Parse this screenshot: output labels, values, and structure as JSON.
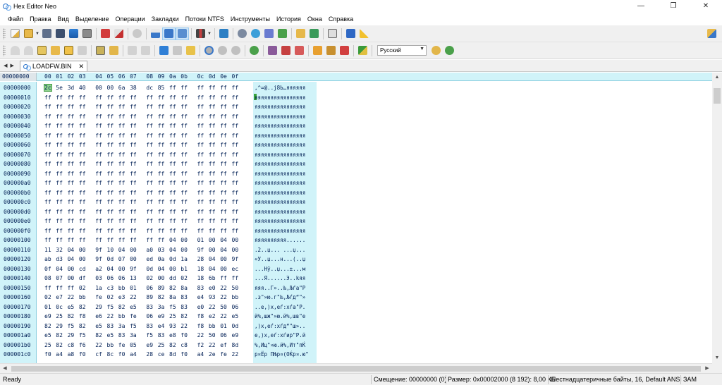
{
  "window": {
    "title": "Hex Editor Neo",
    "controls": [
      "—",
      "❐",
      "✕"
    ]
  },
  "menu": [
    "Файл",
    "Правка",
    "Вид",
    "Выделение",
    "Операции",
    "Закладки",
    "Потоки NTFS",
    "Инструменты",
    "История",
    "Окна",
    "Справка"
  ],
  "toolbar": {
    "language": "Русский"
  },
  "tabs": {
    "nav_label": "◀ ▶",
    "active_label": "LOADFW.BIN",
    "close": "✕"
  },
  "hex": {
    "header_offset": "00000000",
    "columns": [
      "00",
      "01",
      "02",
      "03",
      "04",
      "05",
      "06",
      "07",
      "08",
      "09",
      "0a",
      "0b",
      "0c",
      "0d",
      "0e",
      "0f"
    ],
    "rows": [
      {
        "offset": "00000000",
        "bytes": [
          "2c",
          "5e",
          "3d",
          "40",
          "00",
          "00",
          "6a",
          "38",
          "dc",
          "85",
          "ff",
          "ff",
          "ff",
          "ff",
          "ff",
          "ff"
        ],
        "ascii": ",^=@..j8Ь…яяяяяя"
      },
      {
        "offset": "00000010",
        "bytes": [
          "ff",
          "ff",
          "ff",
          "ff",
          "ff",
          "ff",
          "ff",
          "ff",
          "ff",
          "ff",
          "ff",
          "ff",
          "ff",
          "ff",
          "ff",
          "ff"
        ],
        "ascii": "яяяяяяяяяяяяяяяя"
      },
      {
        "offset": "00000020",
        "bytes": [
          "ff",
          "ff",
          "ff",
          "ff",
          "ff",
          "ff",
          "ff",
          "ff",
          "ff",
          "ff",
          "ff",
          "ff",
          "ff",
          "ff",
          "ff",
          "ff"
        ],
        "ascii": "яяяяяяяяяяяяяяяя"
      },
      {
        "offset": "00000030",
        "bytes": [
          "ff",
          "ff",
          "ff",
          "ff",
          "ff",
          "ff",
          "ff",
          "ff",
          "ff",
          "ff",
          "ff",
          "ff",
          "ff",
          "ff",
          "ff",
          "ff"
        ],
        "ascii": "яяяяяяяяяяяяяяяя"
      },
      {
        "offset": "00000040",
        "bytes": [
          "ff",
          "ff",
          "ff",
          "ff",
          "ff",
          "ff",
          "ff",
          "ff",
          "ff",
          "ff",
          "ff",
          "ff",
          "ff",
          "ff",
          "ff",
          "ff"
        ],
        "ascii": "яяяяяяяяяяяяяяяя"
      },
      {
        "offset": "00000050",
        "bytes": [
          "ff",
          "ff",
          "ff",
          "ff",
          "ff",
          "ff",
          "ff",
          "ff",
          "ff",
          "ff",
          "ff",
          "ff",
          "ff",
          "ff",
          "ff",
          "ff"
        ],
        "ascii": "яяяяяяяяяяяяяяяя"
      },
      {
        "offset": "00000060",
        "bytes": [
          "ff",
          "ff",
          "ff",
          "ff",
          "ff",
          "ff",
          "ff",
          "ff",
          "ff",
          "ff",
          "ff",
          "ff",
          "ff",
          "ff",
          "ff",
          "ff"
        ],
        "ascii": "яяяяяяяяяяяяяяяя"
      },
      {
        "offset": "00000070",
        "bytes": [
          "ff",
          "ff",
          "ff",
          "ff",
          "ff",
          "ff",
          "ff",
          "ff",
          "ff",
          "ff",
          "ff",
          "ff",
          "ff",
          "ff",
          "ff",
          "ff"
        ],
        "ascii": "яяяяяяяяяяяяяяяя"
      },
      {
        "offset": "00000080",
        "bytes": [
          "ff",
          "ff",
          "ff",
          "ff",
          "ff",
          "ff",
          "ff",
          "ff",
          "ff",
          "ff",
          "ff",
          "ff",
          "ff",
          "ff",
          "ff",
          "ff"
        ],
        "ascii": "яяяяяяяяяяяяяяяя"
      },
      {
        "offset": "00000090",
        "bytes": [
          "ff",
          "ff",
          "ff",
          "ff",
          "ff",
          "ff",
          "ff",
          "ff",
          "ff",
          "ff",
          "ff",
          "ff",
          "ff",
          "ff",
          "ff",
          "ff"
        ],
        "ascii": "яяяяяяяяяяяяяяяя"
      },
      {
        "offset": "000000a0",
        "bytes": [
          "ff",
          "ff",
          "ff",
          "ff",
          "ff",
          "ff",
          "ff",
          "ff",
          "ff",
          "ff",
          "ff",
          "ff",
          "ff",
          "ff",
          "ff",
          "ff"
        ],
        "ascii": "яяяяяяяяяяяяяяяя"
      },
      {
        "offset": "000000b0",
        "bytes": [
          "ff",
          "ff",
          "ff",
          "ff",
          "ff",
          "ff",
          "ff",
          "ff",
          "ff",
          "ff",
          "ff",
          "ff",
          "ff",
          "ff",
          "ff",
          "ff"
        ],
        "ascii": "яяяяяяяяяяяяяяяя"
      },
      {
        "offset": "000000c0",
        "bytes": [
          "ff",
          "ff",
          "ff",
          "ff",
          "ff",
          "ff",
          "ff",
          "ff",
          "ff",
          "ff",
          "ff",
          "ff",
          "ff",
          "ff",
          "ff",
          "ff"
        ],
        "ascii": "яяяяяяяяяяяяяяяя"
      },
      {
        "offset": "000000d0",
        "bytes": [
          "ff",
          "ff",
          "ff",
          "ff",
          "ff",
          "ff",
          "ff",
          "ff",
          "ff",
          "ff",
          "ff",
          "ff",
          "ff",
          "ff",
          "ff",
          "ff"
        ],
        "ascii": "яяяяяяяяяяяяяяяя"
      },
      {
        "offset": "000000e0",
        "bytes": [
          "ff",
          "ff",
          "ff",
          "ff",
          "ff",
          "ff",
          "ff",
          "ff",
          "ff",
          "ff",
          "ff",
          "ff",
          "ff",
          "ff",
          "ff",
          "ff"
        ],
        "ascii": "яяяяяяяяяяяяяяяя"
      },
      {
        "offset": "000000f0",
        "bytes": [
          "ff",
          "ff",
          "ff",
          "ff",
          "ff",
          "ff",
          "ff",
          "ff",
          "ff",
          "ff",
          "ff",
          "ff",
          "ff",
          "ff",
          "ff",
          "ff"
        ],
        "ascii": "яяяяяяяяяяяяяяяя"
      },
      {
        "offset": "00000100",
        "bytes": [
          "ff",
          "ff",
          "ff",
          "ff",
          "ff",
          "ff",
          "ff",
          "ff",
          "ff",
          "ff",
          "04",
          "00",
          "01",
          "00",
          "04",
          "00"
        ],
        "ascii": "яяяяяяяяяя......"
      },
      {
        "offset": "00000110",
        "bytes": [
          "11",
          "32",
          "04",
          "00",
          "9f",
          "10",
          "04",
          "00",
          "a0",
          "03",
          "04",
          "00",
          "9f",
          "00",
          "04",
          "00"
        ],
        "ascii": ".2..џ... ...џ..."
      },
      {
        "offset": "00000120",
        "bytes": [
          "ab",
          "d3",
          "04",
          "00",
          "9f",
          "0d",
          "07",
          "00",
          "ed",
          "0a",
          "0d",
          "1a",
          "28",
          "04",
          "00",
          "9f"
        ],
        "ascii": "«У..џ...н...(..џ"
      },
      {
        "offset": "00000130",
        "bytes": [
          "0f",
          "04",
          "00",
          "cd",
          "a2",
          "04",
          "00",
          "9f",
          "0d",
          "04",
          "00",
          "b1",
          "18",
          "04",
          "00",
          "ec"
        ],
        "ascii": "...Нў..џ...±...м"
      },
      {
        "offset": "00000140",
        "bytes": [
          "08",
          "07",
          "00",
          "df",
          "03",
          "06",
          "06",
          "13",
          "02",
          "00",
          "dd",
          "02",
          "18",
          "6b",
          "ff",
          "ff"
        ],
        "ascii": "...Я......Э..kяя"
      },
      {
        "offset": "00000150",
        "bytes": [
          "ff",
          "ff",
          "ff",
          "02",
          "1a",
          "c3",
          "bb",
          "01",
          "06",
          "89",
          "82",
          "8a",
          "83",
          "e0",
          "22",
          "50"
        ],
        "ascii": "яяя..Г»..‰‚Љѓа\"P"
      },
      {
        "offset": "00000160",
        "bytes": [
          "02",
          "e7",
          "22",
          "bb",
          "fe",
          "02",
          "e3",
          "22",
          "89",
          "82",
          "8a",
          "83",
          "e4",
          "93",
          "22",
          "bb"
        ],
        "ascii": ".з\"»ю.г\"‰‚Љѓд“\"»"
      },
      {
        "offset": "00000170",
        "bytes": [
          "01",
          "0c",
          "e5",
          "82",
          "29",
          "f5",
          "82",
          "e5",
          "83",
          "3a",
          "f5",
          "83",
          "e0",
          "22",
          "50",
          "06"
        ],
        "ascii": "..е‚)х‚еѓ:хѓа\"P."
      },
      {
        "offset": "00000180",
        "bytes": [
          "e9",
          "25",
          "82",
          "f8",
          "e6",
          "22",
          "bb",
          "fe",
          "06",
          "e9",
          "25",
          "82",
          "f8",
          "e2",
          "22",
          "e5"
        ],
        "ascii": "й%‚шж\"»ю.й%‚шв\"е"
      },
      {
        "offset": "00000190",
        "bytes": [
          "82",
          "29",
          "f5",
          "82",
          "e5",
          "83",
          "3a",
          "f5",
          "83",
          "e4",
          "93",
          "22",
          "f8",
          "bb",
          "01",
          "0d"
        ],
        "ascii": "‚)х‚еѓ:хѓд“\"ш».."
      },
      {
        "offset": "000001a0",
        "bytes": [
          "e5",
          "82",
          "29",
          "f5",
          "82",
          "e5",
          "83",
          "3a",
          "f5",
          "83",
          "e8",
          "f0",
          "22",
          "50",
          "06",
          "e9"
        ],
        "ascii": "е‚)х‚еѓ:хѓир\"P.й"
      },
      {
        "offset": "000001b0",
        "bytes": [
          "25",
          "82",
          "c8",
          "f6",
          "22",
          "bb",
          "fe",
          "05",
          "e9",
          "25",
          "82",
          "c8",
          "f2",
          "22",
          "ef",
          "8d"
        ],
        "ascii": "%‚Иц\"»ю.й%‚Ит\"пЌ"
      },
      {
        "offset": "000001c0",
        "bytes": [
          "f0",
          "a4",
          "a8",
          "f0",
          "cf",
          "8c",
          "f0",
          "a4",
          "28",
          "ce",
          "8d",
          "f0",
          "a4",
          "2e",
          "fe",
          "22"
        ],
        "ascii": "р¤Ёр ПЊр¤(ОЌр¤.ю\""
      }
    ]
  },
  "status": {
    "ready": "Ready",
    "offset": "Смещение: 00000000 (0)",
    "size": "Размер: 0x00002000 (8 192): 8,00 КБ",
    "mode": "Шестнадцатеричные байты, 16, Default ANSI",
    "ins": "ЗАМ"
  },
  "colors": {
    "hex_bg": "#d0f3f9",
    "selection": "#8fd38f",
    "text": "#001f55"
  }
}
